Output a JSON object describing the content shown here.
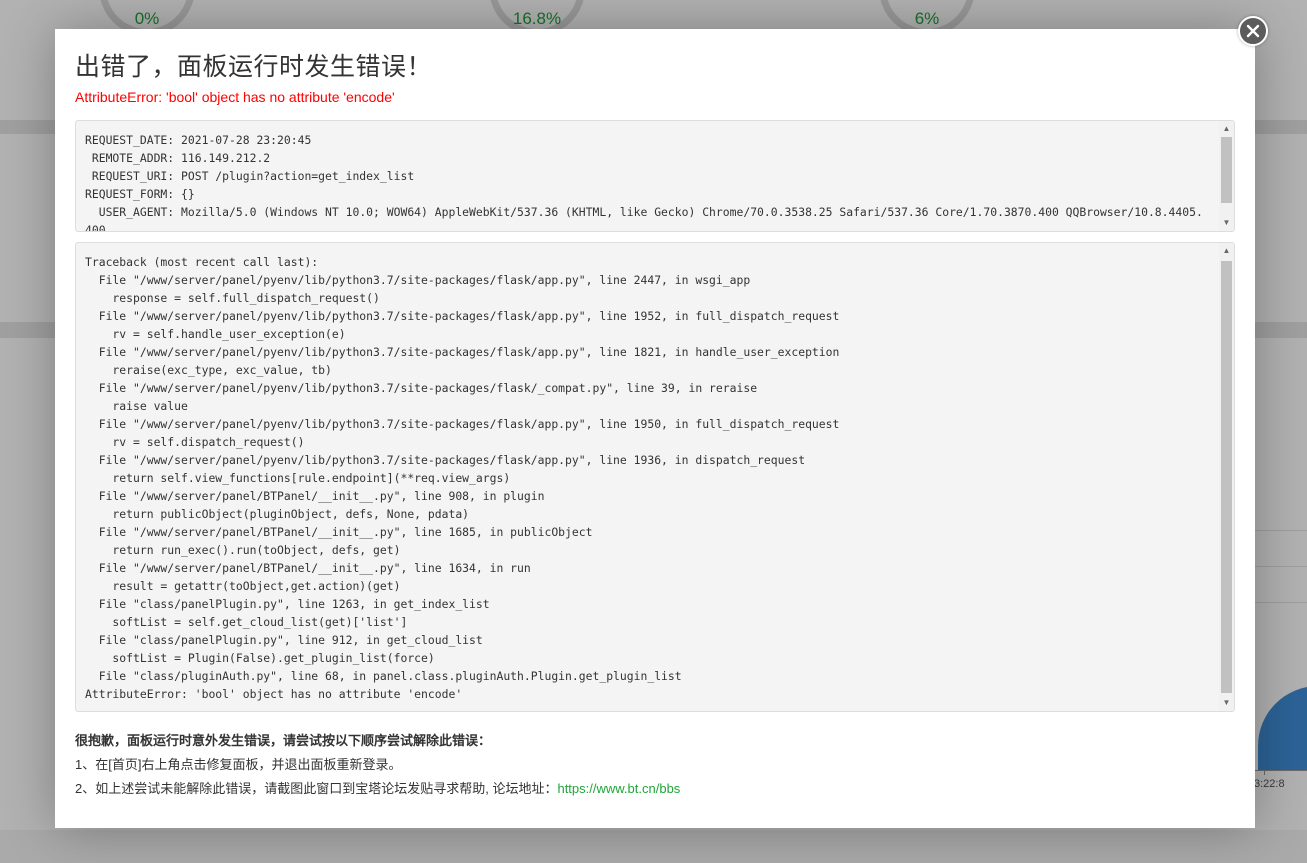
{
  "background": {
    "gauges": [
      "0%",
      "16.8%",
      "6%"
    ],
    "chart_time_label": "3:22:8"
  },
  "modal": {
    "title": "出错了，面板运行时发生错误！",
    "error": "AttributeError: 'bool' object has no attribute 'encode'",
    "request_info": "REQUEST_DATE: 2021-07-28 23:20:45\n REMOTE_ADDR: 116.149.212.2\n REQUEST_URI: POST /plugin?action=get_index_list\nREQUEST_FORM: {}\n  USER_AGENT: Mozilla/5.0 (Windows NT 10.0; WOW64) AppleWebKit/537.36 (KHTML, like Gecko) Chrome/70.0.3538.25 Safari/537.36 Core/1.70.3870.400 QQBrowser/10.8.4405.400",
    "traceback": "Traceback (most recent call last):\n  File \"/www/server/panel/pyenv/lib/python3.7/site-packages/flask/app.py\", line 2447, in wsgi_app\n    response = self.full_dispatch_request()\n  File \"/www/server/panel/pyenv/lib/python3.7/site-packages/flask/app.py\", line 1952, in full_dispatch_request\n    rv = self.handle_user_exception(e)\n  File \"/www/server/panel/pyenv/lib/python3.7/site-packages/flask/app.py\", line 1821, in handle_user_exception\n    reraise(exc_type, exc_value, tb)\n  File \"/www/server/panel/pyenv/lib/python3.7/site-packages/flask/_compat.py\", line 39, in reraise\n    raise value\n  File \"/www/server/panel/pyenv/lib/python3.7/site-packages/flask/app.py\", line 1950, in full_dispatch_request\n    rv = self.dispatch_request()\n  File \"/www/server/panel/pyenv/lib/python3.7/site-packages/flask/app.py\", line 1936, in dispatch_request\n    return self.view_functions[rule.endpoint](**req.view_args)\n  File \"/www/server/panel/BTPanel/__init__.py\", line 908, in plugin\n    return publicObject(pluginObject, defs, None, pdata)\n  File \"/www/server/panel/BTPanel/__init__.py\", line 1685, in publicObject\n    return run_exec().run(toObject, defs, get)\n  File \"/www/server/panel/BTPanel/__init__.py\", line 1634, in run\n    result = getattr(toObject,get.action)(get)\n  File \"class/panelPlugin.py\", line 1263, in get_index_list\n    softList = self.get_cloud_list(get)['list']\n  File \"class/panelPlugin.py\", line 912, in get_cloud_list\n    softList = Plugin(False).get_plugin_list(force)\n  File \"class/pluginAuth.py\", line 68, in panel.class.pluginAuth.Plugin.get_plugin_list\nAttributeError: 'bool' object has no attribute 'encode'",
    "help_title": "很抱歉，面板运行时意外发生错误，请尝试按以下顺序尝试解除此错误：",
    "help_step1": "1、在[首页]右上角点击修复面板，并退出面板重新登录。",
    "help_step2_prefix": "2、如上述尝试未能解除此错误，请截图此窗口到宝塔论坛发贴寻求帮助, 论坛地址：",
    "help_link": "https://www.bt.cn/bbs",
    "close_icon": "close-icon",
    "accent_color": "#20a53a",
    "error_color": "#ff0000"
  }
}
